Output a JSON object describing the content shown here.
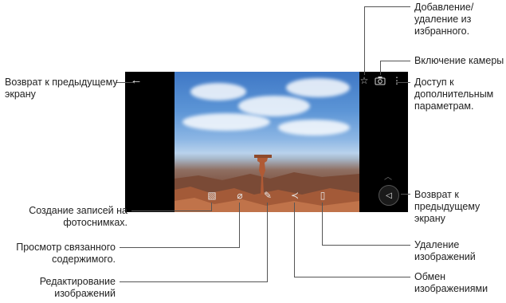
{
  "callouts": {
    "back_prev": "Возврат к предыдущему\nэкрану",
    "favorites": "Добавление/\nудаление из\nизбранного.",
    "camera": "Включение камеры",
    "more_options": "Доступ к\nдополнительным\nпараметрам.",
    "nav_back": "Возврат к\nпредыдущему\nэкрану",
    "notes": "Создание записей на\nфотоснимках.",
    "related": "Просмотр связанного\nсодержимого.",
    "edit": "Редактирование\nизображений",
    "delete": "Удаление\nизображений",
    "share": "Обмен\nизображениями"
  },
  "icons": {
    "back": "arrow-left-icon",
    "star": "star-outline-icon",
    "camera": "camera-icon",
    "more": "more-vert-icon",
    "nav_back": "triangle-left-icon",
    "note": "note-icon",
    "related": "link-icon",
    "edit": "pencil-icon",
    "share": "share-icon",
    "trash": "trash-icon"
  }
}
